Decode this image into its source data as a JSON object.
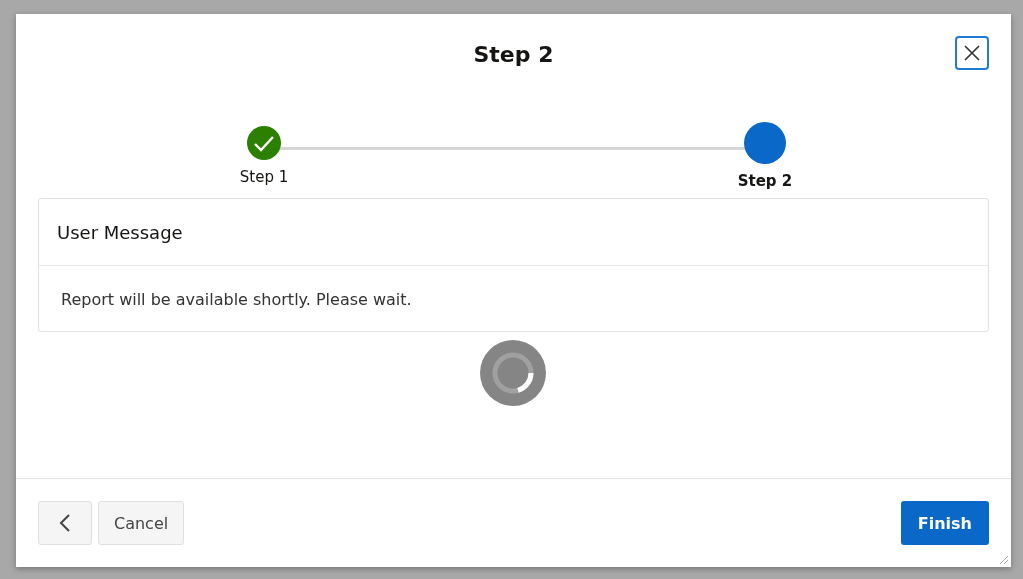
{
  "dialog": {
    "title": "Step 2"
  },
  "steps": [
    {
      "label": "Step 1",
      "completed": true,
      "selected": false
    },
    {
      "label": "Step 2",
      "completed": false,
      "selected": true
    }
  ],
  "region": {
    "title": "User Message",
    "message": "Report will be available shortly. Please wait."
  },
  "loading": true,
  "buttons": [
    {
      "kind": "back"
    },
    {
      "kind": "text",
      "label": "Cancel",
      "primary": false
    },
    {
      "kind": "text",
      "label": "Finish",
      "primary": true
    }
  ]
}
